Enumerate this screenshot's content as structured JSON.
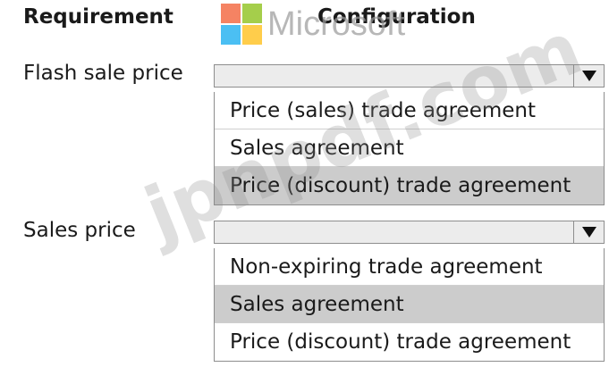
{
  "headers": {
    "requirement": "Requirement",
    "configuration": "Configuration"
  },
  "logo": {
    "text": "Microsoft"
  },
  "watermark": {
    "text": "jpnpdf.com"
  },
  "rows": [
    {
      "label": "Flash sale price",
      "selected_value": "",
      "options": [
        "Price (sales) trade agreement",
        "Sales agreement",
        "Price (discount) trade agreement"
      ],
      "highlighted_index": 2
    },
    {
      "label": "Sales price",
      "selected_value": "",
      "options": [
        "Non-expiring trade agreement",
        "Sales agreement",
        "Price (discount) trade agreement"
      ],
      "highlighted_index": 1
    }
  ],
  "colors": {
    "highlight": "#cccccc",
    "select_bg": "#ececec",
    "border": "#8d8d8d"
  }
}
